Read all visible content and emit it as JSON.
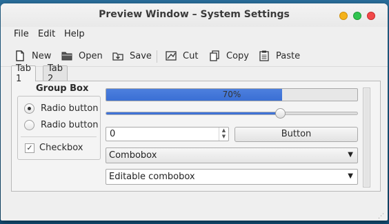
{
  "window": {
    "title": "Preview Window – System Settings"
  },
  "menubar": {
    "items": [
      "File",
      "Edit",
      "Help"
    ]
  },
  "toolbar": {
    "items": [
      {
        "label": "New",
        "icon": "new-file-icon"
      },
      {
        "label": "Open",
        "icon": "folder-icon"
      },
      {
        "label": "Save",
        "icon": "save-icon"
      },
      {
        "label": "Cut",
        "icon": "cut-icon"
      },
      {
        "label": "Copy",
        "icon": "copy-icon"
      },
      {
        "label": "Paste",
        "icon": "paste-icon"
      }
    ]
  },
  "tabs": [
    {
      "label": "Tab 1",
      "active": true
    },
    {
      "label": "Tab 2",
      "active": false
    }
  ],
  "groupbox": {
    "title": "Group Box",
    "radios": [
      {
        "label": "Radio button",
        "checked": true
      },
      {
        "label": "Radio button",
        "checked": false
      }
    ],
    "checkbox": {
      "label": "Checkbox",
      "checked": true
    }
  },
  "progress": {
    "value_text": "70%",
    "value": 0.7
  },
  "slider": {
    "value": 0.69
  },
  "spinbox": {
    "value": "0"
  },
  "button": {
    "label": "Button"
  },
  "combobox": {
    "value": "Combobox"
  },
  "editable_combobox": {
    "value": "Editable combobox"
  },
  "colors": {
    "accent": "#3a6fd4",
    "window_bg": "#efefef",
    "desktop": "#185a86"
  }
}
